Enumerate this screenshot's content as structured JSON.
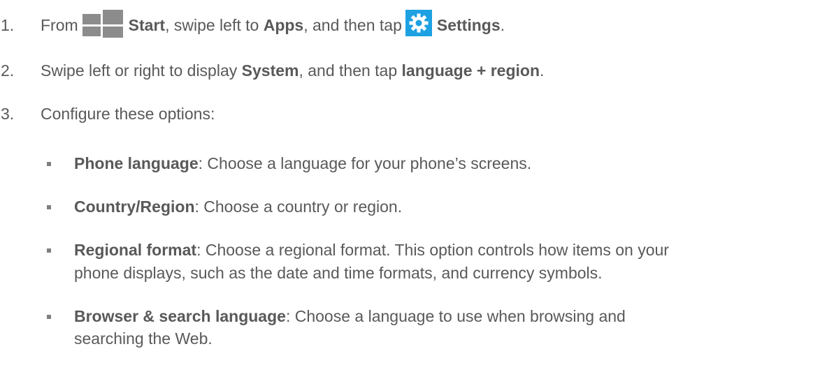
{
  "steps": [
    {
      "number": "1.",
      "parts": {
        "from": "From",
        "start": "Start",
        "mid": ", swipe left to",
        "apps": "Apps",
        "mid2": ", and then tap",
        "settings": "Settings",
        "end": "."
      },
      "icons": [
        "windows-start-icon",
        "settings-gear-icon"
      ]
    },
    {
      "number": "2.",
      "parts": {
        "pre": "Swipe left or right to display",
        "system": "System",
        "mid": ", and then tap",
        "language_region": "language + region",
        "end": "."
      }
    },
    {
      "number": "3.",
      "text": "Configure these options:"
    }
  ],
  "options": [
    {
      "term": "Phone language",
      "desc": ": Choose a language for your phone’s screens."
    },
    {
      "term": "Country/Region",
      "desc": ": Choose a country or region."
    },
    {
      "term": "Regional format",
      "desc": ": Choose a regional format. This option controls how items on your",
      "desc_line2": "phone displays, such as the date and time formats, and currency symbols."
    },
    {
      "term": "Browser & search language",
      "desc": ": Choose a language to use when browsing and",
      "desc_line2": "searching the Web."
    }
  ],
  "colors": {
    "text": "#595959",
    "settings_tile": "#1da1e2",
    "start_icon": "#8c8c8c"
  }
}
